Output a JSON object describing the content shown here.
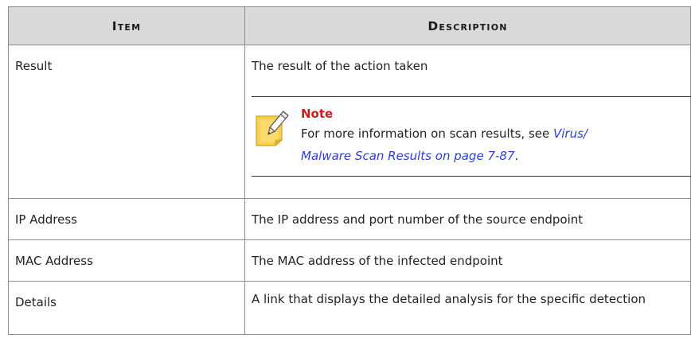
{
  "table": {
    "headers": {
      "item": "Item",
      "description": "Description"
    },
    "rows": [
      {
        "item": "Result",
        "description": "The result of the action taken"
      },
      {
        "item": "IP Address",
        "description": "The IP address and port number of the source endpoint"
      },
      {
        "item": "MAC Address",
        "description": "The MAC address of the infected endpoint"
      },
      {
        "item": "Details",
        "description": "A link that displays the detailed analysis for the specific detection"
      }
    ]
  },
  "note": {
    "title": "Note",
    "text_before": "For more information on scan results, see ",
    "link_line1": "Virus/",
    "link_line2": "Malware Scan Results on page 7-87",
    "text_after": ".",
    "icon": "note-pencil-icon"
  }
}
